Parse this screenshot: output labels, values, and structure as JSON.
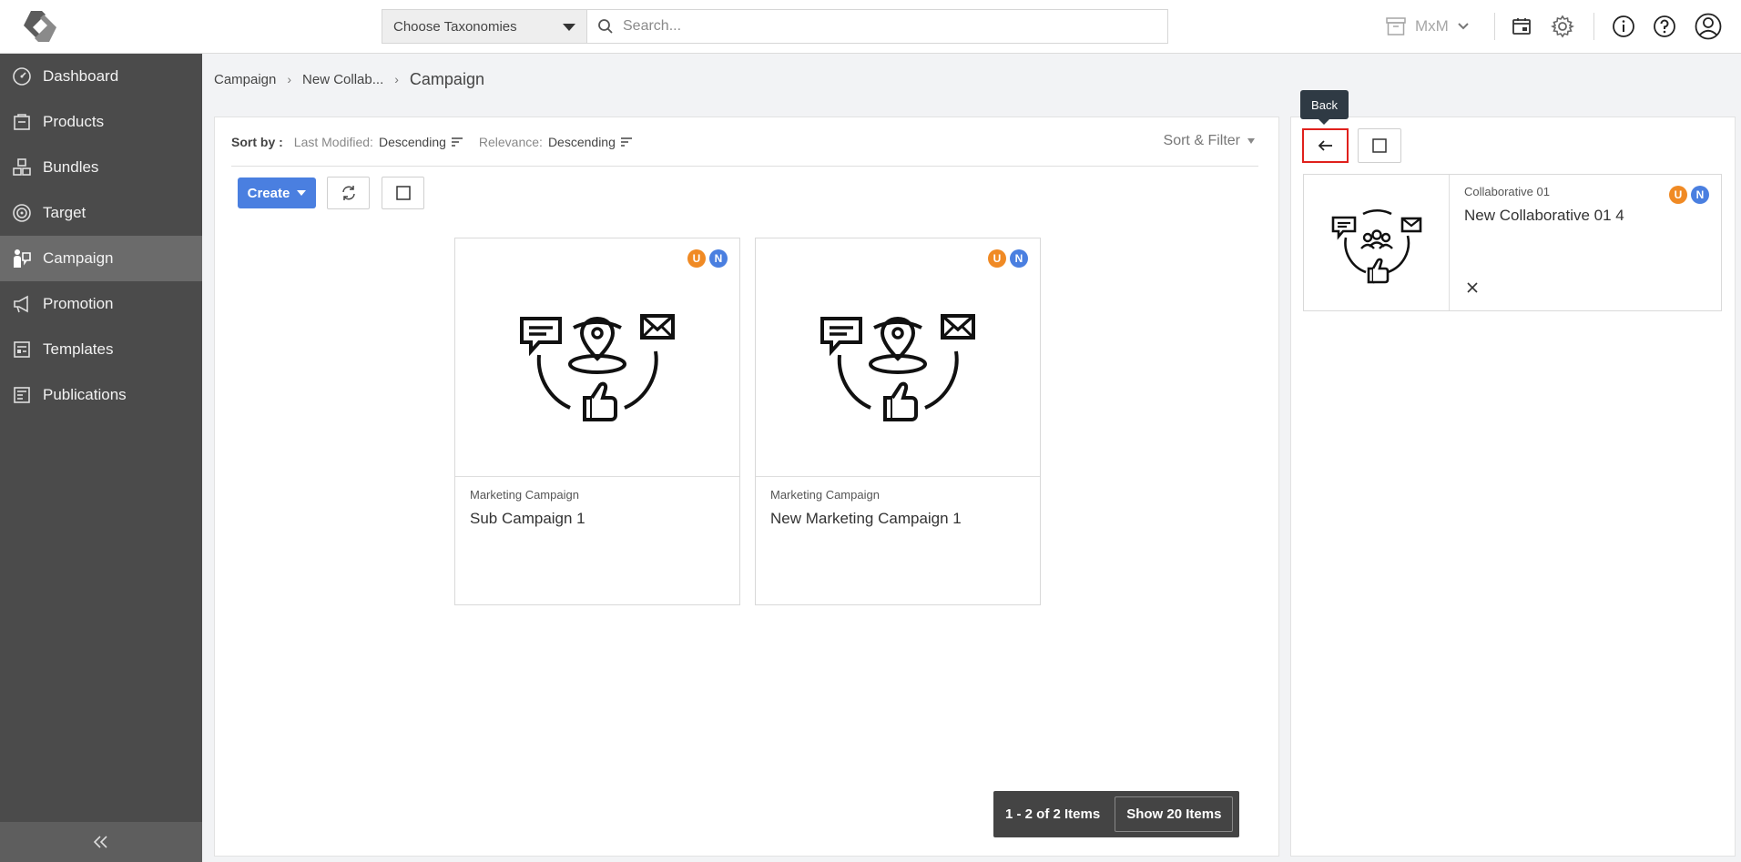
{
  "header": {
    "taxonomy_label": "Choose Taxonomies",
    "search_placeholder": "Search...",
    "workspace_label": "MxM"
  },
  "sidebar": {
    "items": [
      {
        "label": "Dashboard",
        "icon": "dashboard-icon"
      },
      {
        "label": "Products",
        "icon": "products-icon"
      },
      {
        "label": "Bundles",
        "icon": "bundles-icon"
      },
      {
        "label": "Target",
        "icon": "target-icon"
      },
      {
        "label": "Campaign",
        "icon": "campaign-icon",
        "active": true
      },
      {
        "label": "Promotion",
        "icon": "promotion-icon"
      },
      {
        "label": "Templates",
        "icon": "templates-icon"
      },
      {
        "label": "Publications",
        "icon": "publications-icon"
      }
    ]
  },
  "breadcrumb": {
    "items": [
      "Campaign",
      "New Collab..."
    ],
    "current": "Campaign"
  },
  "sortbar": {
    "label": "Sort by :",
    "sort1_key": "Last Modified:",
    "sort1_value": "Descending",
    "sort2_key": "Relevance:",
    "sort2_value": "Descending",
    "filter_label": "Sort & Filter"
  },
  "toolbar": {
    "create_label": "Create"
  },
  "cards": [
    {
      "type": "Marketing Campaign",
      "title": "Sub Campaign 1",
      "badges": [
        "U",
        "N"
      ]
    },
    {
      "type": "Marketing Campaign",
      "title": "New Marketing Campaign 1",
      "badges": [
        "U",
        "N"
      ]
    }
  ],
  "pager": {
    "range_label": "1 - 2 of 2 Items",
    "show_label": "Show 20 Items"
  },
  "right_panel": {
    "tooltip": "Back",
    "card": {
      "type": "Collaborative 01",
      "title": "New Collaborative 01 4",
      "badges": [
        "U",
        "N"
      ]
    }
  },
  "colors": {
    "accent": "#4a7fe0",
    "badge_u": "#f08a24",
    "badge_n": "#4a7fe0",
    "sidebar": "#4b4b4b",
    "highlight": "#e0201c"
  }
}
